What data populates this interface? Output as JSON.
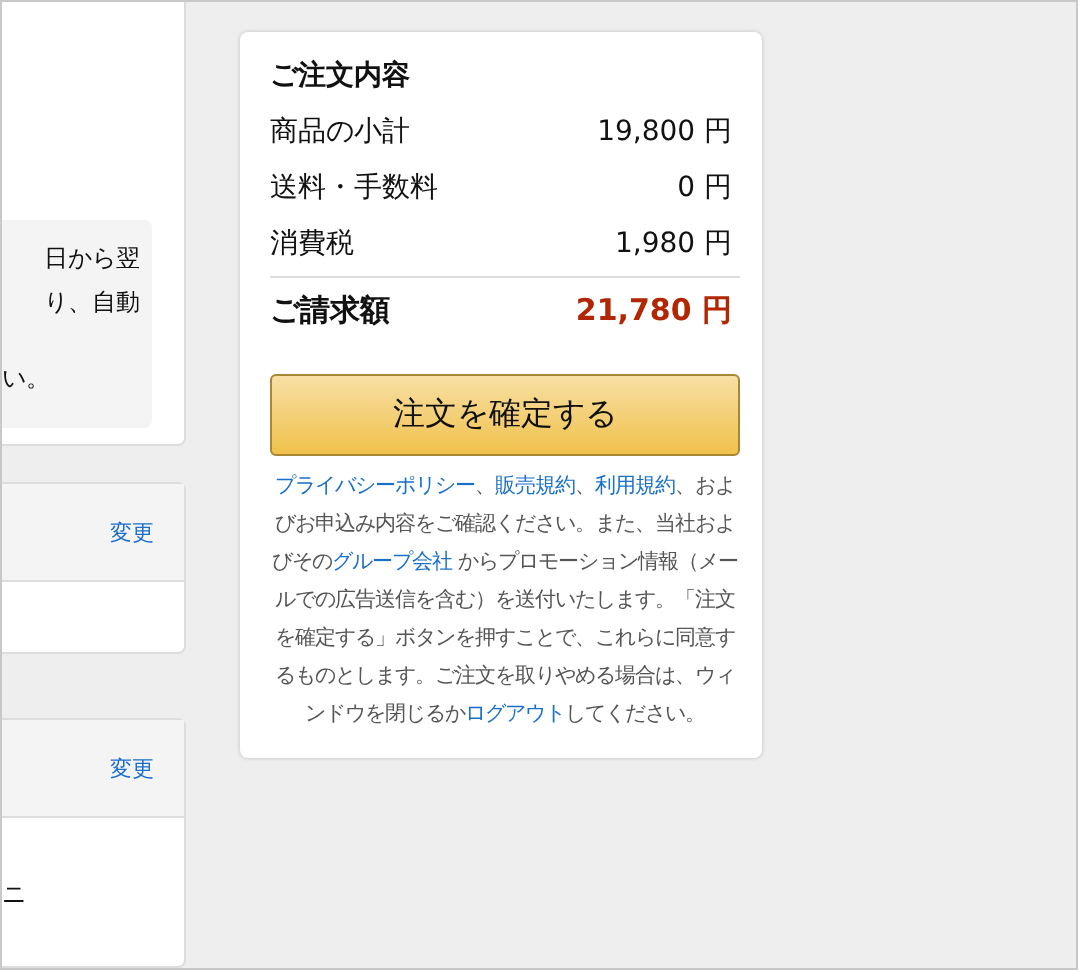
{
  "left_panel": {
    "notice_lines": [
      "日から翌",
      "り、自動",
      "い。"
    ],
    "sections": [
      {
        "action": "変更"
      },
      {
        "action": "変更",
        "body": "ニ"
      }
    ]
  },
  "summary": {
    "title": "ご注文内容",
    "rows": [
      {
        "label": "商品の小計",
        "amount": "19,800 円"
      },
      {
        "label": "送料・手数料",
        "amount": "0 円"
      },
      {
        "label": "消費税",
        "amount": "1,980 円"
      }
    ],
    "total": {
      "label": "ご請求額",
      "amount": "21,780 円"
    },
    "button": "注文を確定する",
    "terms": [
      {
        "text": "プライバシーポリシー",
        "link": true
      },
      {
        "text": "、",
        "link": false
      },
      {
        "text": "販売規約",
        "link": true
      },
      {
        "text": "、",
        "link": false
      },
      {
        "text": "利用規約",
        "link": true
      },
      {
        "text": "、およびお申込み内容をご確認ください。また、当社およびその",
        "link": false
      },
      {
        "text": "グループ会社",
        "link": true
      },
      {
        "text": " からプロモーション情報（メールでの広告送信を含む）を送付いたします。「注文を確定する」ボタンを押すことで、これらに同意するものとします。ご注文を取りやめる場合は、ウィンドウを閉じるか",
        "link": false
      },
      {
        "text": "ログアウト",
        "link": true
      },
      {
        "text": "してください。",
        "link": false
      }
    ]
  }
}
